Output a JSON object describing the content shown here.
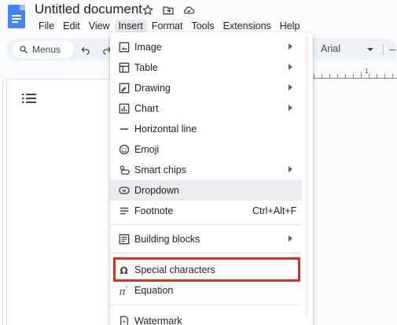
{
  "document": {
    "title": "Untitled document"
  },
  "title_icons": [
    "star-icon",
    "folder-move-icon",
    "cloud-status-icon"
  ],
  "menubar": [
    "File",
    "Edit",
    "View",
    "Insert",
    "Format",
    "Tools",
    "Extensions",
    "Help"
  ],
  "menubar_active": "Insert",
  "toolbar": {
    "search_label": "Menus",
    "font": "Arial",
    "zoom_out_label": "–"
  },
  "ruler": {
    "label": "1"
  },
  "insert_menu": {
    "items": [
      {
        "label": "Image",
        "icon": "image-icon",
        "submenu": true
      },
      {
        "label": "Table",
        "icon": "table-icon",
        "submenu": true
      },
      {
        "label": "Drawing",
        "icon": "drawing-icon",
        "submenu": true
      },
      {
        "label": "Chart",
        "icon": "chart-icon",
        "submenu": true
      },
      {
        "label": "Horizontal line",
        "icon": "horizontal-line-icon"
      },
      {
        "label": "Emoji",
        "icon": "emoji-icon"
      },
      {
        "label": "Smart chips",
        "icon": "smart-chips-icon",
        "submenu": true
      },
      {
        "label": "Dropdown",
        "icon": "dropdown-icon",
        "hovered": true
      },
      {
        "label": "Footnote",
        "icon": "footnote-icon",
        "shortcut": "Ctrl+Alt+F"
      },
      {
        "label": "Building blocks",
        "icon": "building-blocks-icon",
        "submenu": true
      },
      {
        "label": "Special characters",
        "icon": "omega-icon",
        "highlighted": true
      },
      {
        "label": "Equation",
        "icon": "pi-icon"
      },
      {
        "label": "Watermark",
        "icon": "watermark-icon"
      }
    ]
  },
  "colors": {
    "brand_blue": "#4285f4",
    "highlight_red": "#d93025",
    "toolbar_bg": "#edf2fa",
    "hover_bg": "#e9ebee"
  }
}
